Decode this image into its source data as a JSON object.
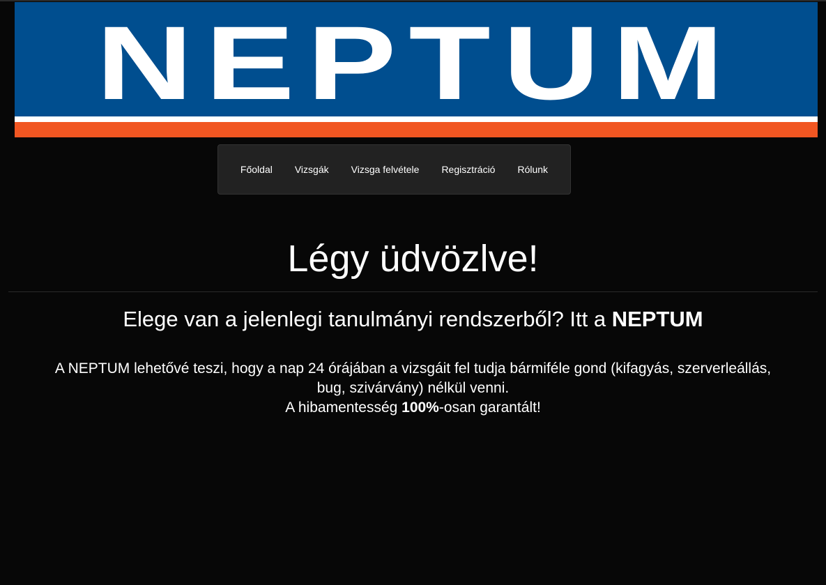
{
  "banner": {
    "logo_text": "NEPTUM",
    "colors": {
      "blue": "#004e8f",
      "orange": "#f15622",
      "white": "#ffffff"
    }
  },
  "nav": {
    "items": [
      {
        "label": "Főoldal"
      },
      {
        "label": "Vizsgák"
      },
      {
        "label": "Vizsga felvétele"
      },
      {
        "label": "Regisztráció"
      },
      {
        "label": "Rólunk"
      }
    ]
  },
  "main": {
    "welcome": "Légy üdvözlve!",
    "subheading_prefix": "Elege van a jelenlegi tanulmányi rendszerből? Itt a ",
    "subheading_bold": "NEPTUM",
    "description_line1": "A NEPTUM lehetővé teszi, hogy a nap 24 órájában a vizsgáit fel tudja bármiféle gond (kifagyás, szerverleállás, bug, szivárvány) nélkül venni.",
    "description_line2_prefix": "A hibamentesség ",
    "description_line2_bold": "100%",
    "description_line2_suffix": "-osan garantált!"
  }
}
